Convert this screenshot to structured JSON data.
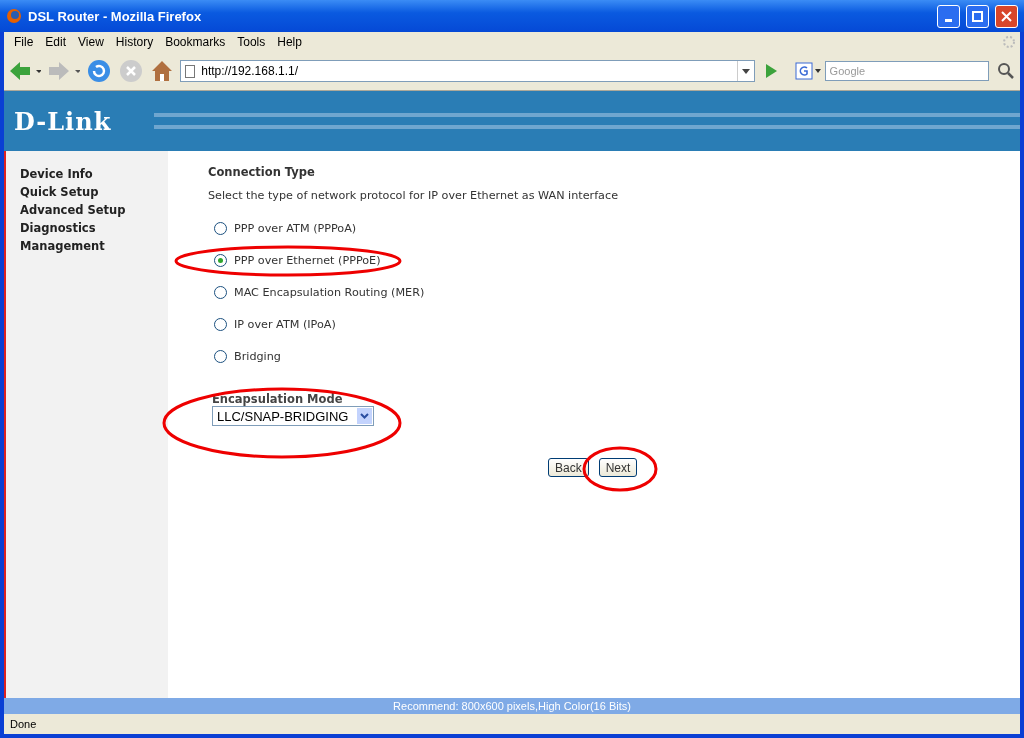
{
  "window": {
    "title": "DSL Router - Mozilla Firefox"
  },
  "menu": [
    "File",
    "Edit",
    "View",
    "History",
    "Bookmarks",
    "Tools",
    "Help"
  ],
  "address": {
    "value": "http://192.168.1.1/"
  },
  "search": {
    "placeholder": "Google"
  },
  "brand": {
    "logo": "D-Link"
  },
  "sidebar": {
    "items": [
      "Device Info",
      "Quick Setup",
      "Advanced Setup",
      "Diagnostics",
      "Management"
    ]
  },
  "content": {
    "title": "Connection Type",
    "instruction": "Select the type of network protocol for IP over Ethernet as WAN interface",
    "options": [
      {
        "label": "PPP over ATM (PPPoA)",
        "selected": false
      },
      {
        "label": "PPP over Ethernet (PPPoE)",
        "selected": true
      },
      {
        "label": "MAC Encapsulation Routing (MER)",
        "selected": false
      },
      {
        "label": "IP over ATM (IPoA)",
        "selected": false
      },
      {
        "label": "Bridging",
        "selected": false
      }
    ],
    "encapsulation": {
      "label": "Encapsulation Mode",
      "value": "LLC/SNAP-BRIDGING"
    },
    "buttons": [
      "Back",
      "Next"
    ]
  },
  "footer": "Recommend: 800x600 pixels,High Color(16 Bits)",
  "status_bar": "Done"
}
